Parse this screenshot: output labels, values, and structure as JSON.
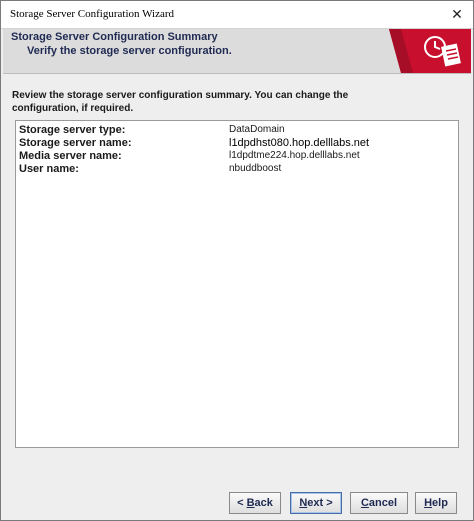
{
  "window": {
    "title": "Storage Server Configuration Wizard",
    "close_glyph": "✕"
  },
  "header": {
    "title": "Storage Server Configuration Summary",
    "subtitle": "Verify the storage server configuration.",
    "graphic_icon": "clock-document-icon",
    "accent_color": "#c8102e"
  },
  "intro": "Review the storage server configuration summary. You can change the configuration, if required.",
  "summary": {
    "rows": [
      {
        "label": "Storage server type:",
        "value": "DataDomain"
      },
      {
        "label": "Storage server name:",
        "value": "l1dpdhst080.hop.delllabs.net"
      },
      {
        "label": "Media server name:",
        "value": "l1dpdtme224.hop.delllabs.net"
      },
      {
        "label": "User name:",
        "value": "nbuddboost"
      }
    ]
  },
  "buttons": {
    "back_prefix": "< ",
    "back_mnemonic": "B",
    "back_rest": "ack",
    "next_mnemonic": "N",
    "next_rest": "ext >",
    "cancel_mnemonic": "C",
    "cancel_rest": "ancel",
    "help_mnemonic": "H",
    "help_rest": "elp"
  }
}
